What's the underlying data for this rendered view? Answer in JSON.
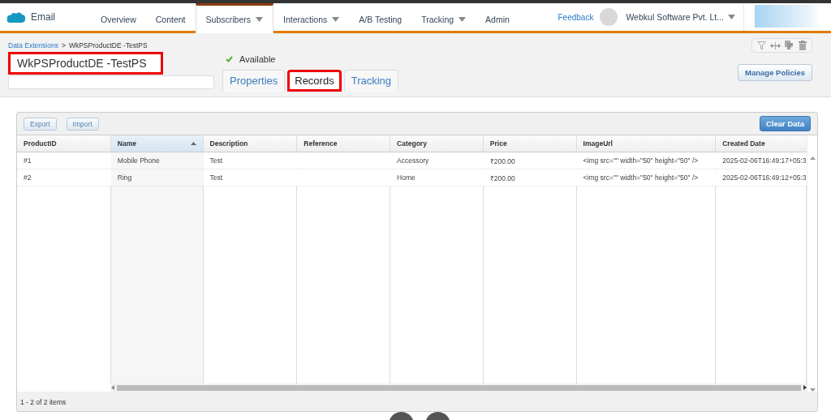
{
  "nav": {
    "app": "Email",
    "items": [
      {
        "label": "Overview",
        "selected": false,
        "dropdown": false
      },
      {
        "label": "Content",
        "selected": false,
        "dropdown": false
      },
      {
        "label": "Subscribers",
        "selected": true,
        "dropdown": true
      },
      {
        "label": "Interactions",
        "selected": false,
        "dropdown": true
      },
      {
        "label": "A/B Testing",
        "selected": false,
        "dropdown": false
      },
      {
        "label": "Tracking",
        "selected": false,
        "dropdown": true
      },
      {
        "label": "Admin",
        "selected": false,
        "dropdown": false
      }
    ],
    "feedback": "Feedback",
    "account": "Webkul Software Pvt. Lt..."
  },
  "breadcrumb": {
    "parent": "Data Extensions",
    "separator": ">",
    "current": "WkPSProductDE -TestPS"
  },
  "name_field": {
    "value": "WkPSProductDE -TestPS",
    "highlighted": true
  },
  "status": "Available",
  "tabs": [
    {
      "label": "Properties",
      "selected": false,
      "highlighted": false
    },
    {
      "label": "Records",
      "selected": true,
      "highlighted": true
    },
    {
      "label": "Tracking",
      "selected": false,
      "highlighted": false
    }
  ],
  "manage_button": "Manage Policies",
  "grid": {
    "buttons": [
      "Export",
      "Import"
    ],
    "clear_button": "Clear Data",
    "columns": [
      {
        "label": "ProductID",
        "sorted": false
      },
      {
        "label": "Name",
        "sorted": true
      },
      {
        "label": "Description",
        "sorted": false
      },
      {
        "label": "Reference",
        "sorted": false
      },
      {
        "label": "Category",
        "sorted": false
      },
      {
        "label": "Price",
        "sorted": false
      },
      {
        "label": "ImageUrl",
        "sorted": false
      },
      {
        "label": "Created Date",
        "sorted": false
      }
    ],
    "rows": [
      [
        "#1",
        "Mobile Phone",
        "Test",
        "",
        "Accessory",
        "₹200.00",
        "<img src=\"\" width=\"50\" height=\"50\" />",
        "2025-02-06T16:49:17+05:3"
      ],
      [
        "#2",
        "Ring",
        "Test",
        "",
        "Home",
        "₹200.00",
        "<img src=\"\" width=\"50\" height=\"50\" />",
        "2025-02-06T16:49:12+05:3"
      ]
    ],
    "pager": "1 - 2 of 2 items"
  }
}
